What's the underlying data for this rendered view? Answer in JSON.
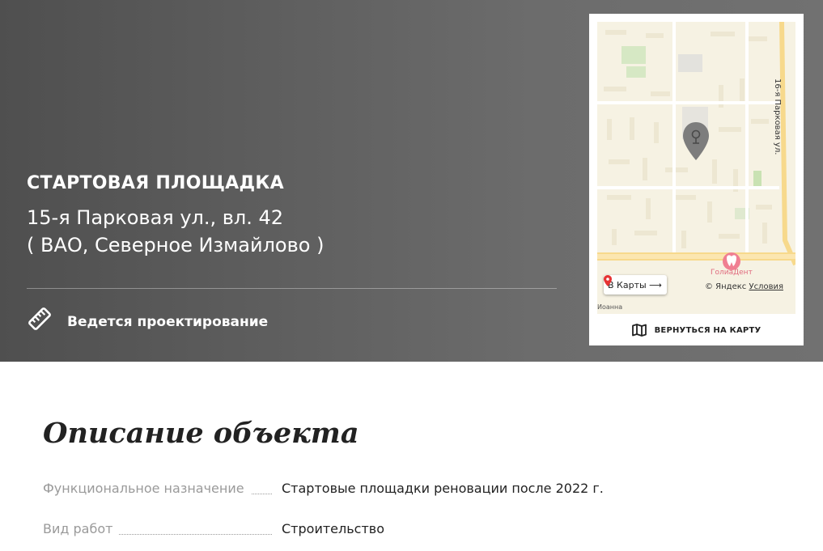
{
  "hero": {
    "title": "СТАРТОВАЯ ПЛОЩАДКА",
    "address_line1": "15-я Парковая ул., вл. 42",
    "address_line2": "( ВАО, Северное Измайлово )",
    "status_label": "Ведется проектирование",
    "status_icon": "ruler-icon",
    "background_color": "#5f5f5f"
  },
  "map": {
    "street_label": "16-я Парковая ул.",
    "poi_label": "ГолиаДент",
    "edge_label": "Иоанна",
    "open_maps_label": "В Карты ⟶",
    "copyright_text": "© Яндекс",
    "terms_label": "Условия",
    "back_to_map_label": "ВЕРНУТЬСЯ НА КАРТУ",
    "back_icon": "folded-map-icon",
    "marker_icon": "location-pin-icon",
    "marker_color": "#7d7d7d",
    "map_bg_color": "#f6f2e3"
  },
  "description": {
    "title": "Описание объекта",
    "rows": [
      {
        "label": "Функциональное назначение",
        "value": "Стартовые площадки реновации после 2022 г."
      },
      {
        "label": "Вид работ",
        "value": "Строительство"
      }
    ]
  }
}
